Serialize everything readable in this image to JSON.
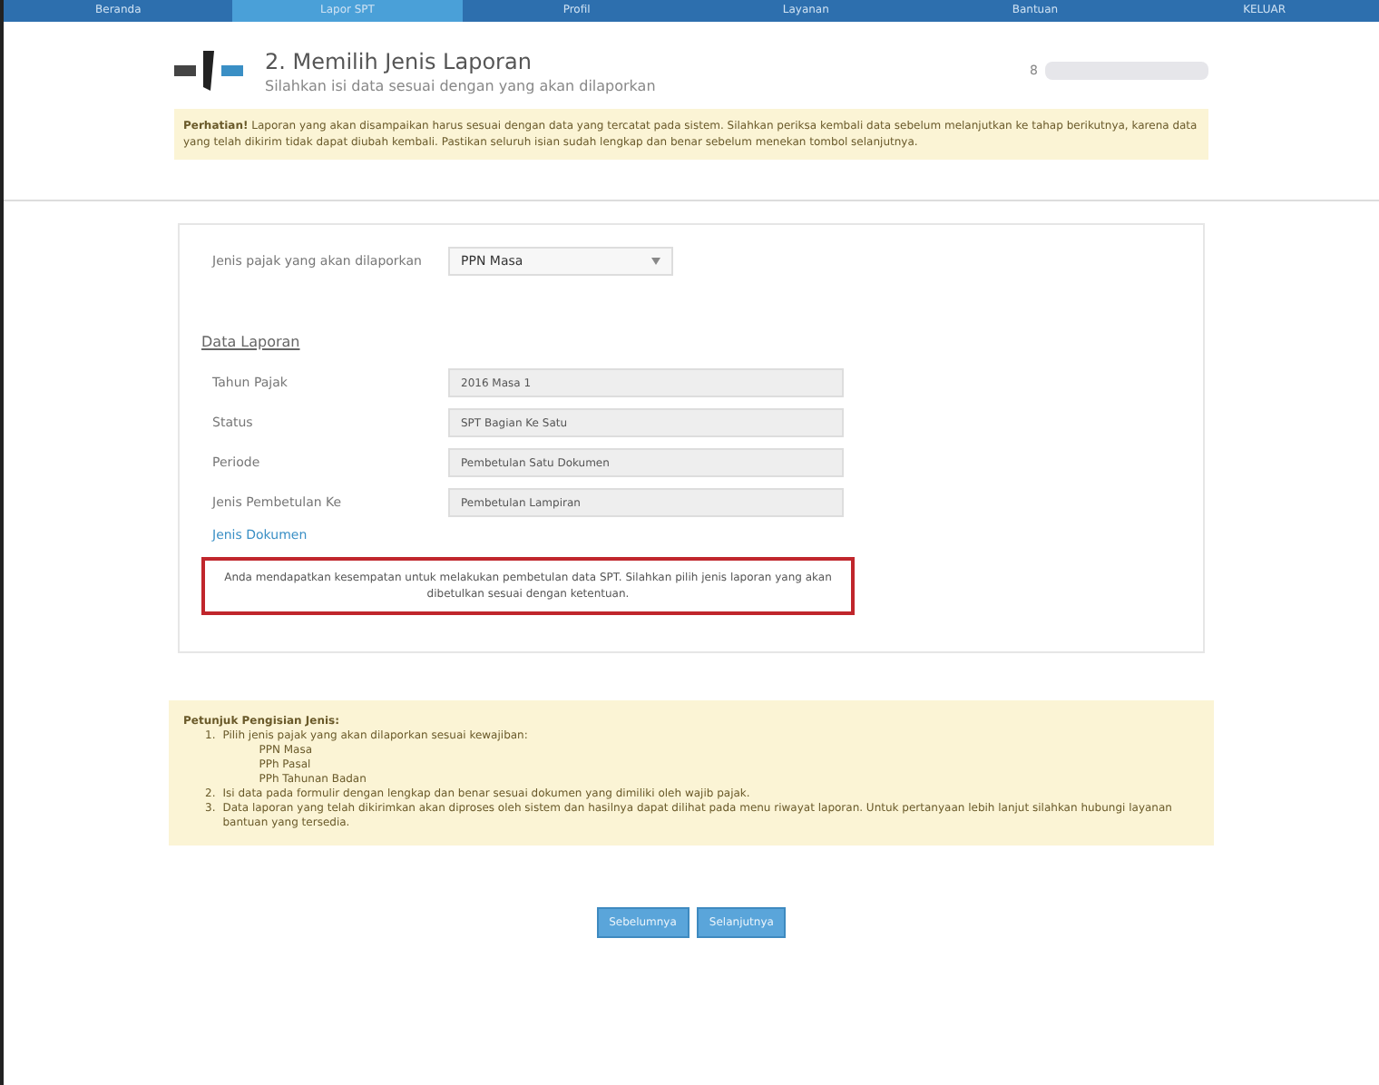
{
  "nav": [
    {
      "label": "Beranda",
      "selected": false
    },
    {
      "label": "Lapor SPT",
      "selected": true
    },
    {
      "label": "Profil",
      "selected": false
    },
    {
      "label": "Layanan",
      "selected": false
    },
    {
      "label": "Bantuan",
      "selected": false
    },
    {
      "label": "KELUAR",
      "selected": false
    }
  ],
  "header": {
    "step": "2. Memilih Jenis Laporan",
    "subtitle": "Silahkan isi data sesuai dengan yang akan dilaporkan",
    "user": "8"
  },
  "alert": {
    "text": "**Perhatian!** Laporan yang akan disampaikan harus sesuai dengan data yang tercatat pada sistem. Silahkan periksa kembali data sebelum melanjutkan ke tahap berikutnya, karena data yang telah dikirim tidak dapat diubah kembali. Pastikan seluruh isian sudah lengkap dan benar sebelum menekan tombol selanjutnya."
  },
  "form": {
    "type_label": "Jenis pajak yang akan dilaporkan",
    "type_value": "PPN Masa",
    "section_title": "Data Laporan",
    "fields": [
      {
        "label": "Tahun Pajak",
        "value": "2016 Masa 1"
      },
      {
        "label": "Status",
        "value": "SPT Bagian Ke Satu"
      },
      {
        "label": "Periode",
        "value": "Pembetulan Satu Dokumen"
      },
      {
        "label": "Jenis Pembetulan Ke",
        "value": "Pembetulan Lampiran"
      }
    ],
    "extra_label": "Jenis Dokumen",
    "warning": "Anda mendapatkan kesempatan untuk melakukan pembetulan data SPT. Silahkan pilih jenis laporan yang akan dibetulkan sesuai dengan ketentuan."
  },
  "note": {
    "title": "Petunjuk Pengisian Jenis:",
    "items": [
      {
        "marker": "1.",
        "text": "Pilih jenis pajak yang akan dilaporkan sesuai kewajiban:",
        "children": [
          "PPN Masa",
          "PPh Pasal",
          "PPh Tahunan Badan"
        ]
      },
      {
        "marker": "2.",
        "text": "Isi data pada formulir dengan lengkap dan benar sesuai dokumen yang dimiliki oleh wajib pajak."
      },
      {
        "marker": "3.",
        "text": "Data laporan yang telah dikirimkan akan diproses oleh sistem dan hasilnya dapat dilihat pada menu riwayat laporan. Untuk pertanyaan lebih lanjut silahkan hubungi layanan bantuan yang tersedia."
      }
    ]
  },
  "buttons": [
    "Sebelumnya",
    "Selanjutnya"
  ]
}
